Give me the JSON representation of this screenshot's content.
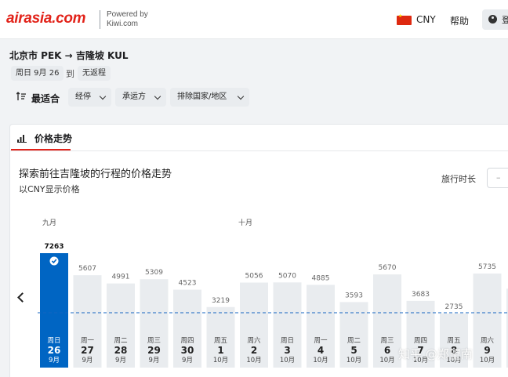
{
  "header": {
    "logo": "airasia.com",
    "powered_line1": "Powered by",
    "powered_line2": "Kiwi.com",
    "currency": "CNY",
    "help": "帮助",
    "account_label": "登"
  },
  "route": {
    "title": "北京市 PEK → 吉隆坡 KUL",
    "depart_chip": "周日 9月 26",
    "to_word": "到",
    "return_chip": "无返程"
  },
  "sort": {
    "label": "最适合"
  },
  "filters": [
    "经停",
    "承运方",
    "排除国家/地区"
  ],
  "tab": {
    "label": "价格走势"
  },
  "chart_panel": {
    "title": "探索前往吉隆坡的行程的价格走势",
    "subtitle": "以CNY显示价格",
    "duration_label": "旅行时长",
    "duration_value": "–",
    "month_sep": "九月",
    "month_oct": "十月"
  },
  "watermark": "知乎 @郑望南",
  "colors": {
    "brand": "#e2231a",
    "selected_bar": "#0065c3",
    "bar": "#e9ecef",
    "avg_line": "#1565c0"
  },
  "chart_data": {
    "type": "bar",
    "title": "",
    "selected_index": 0,
    "bars": [
      {
        "weekday": "周日",
        "day": "26",
        "month": "9月",
        "value": 7263
      },
      {
        "weekday": "周一",
        "day": "27",
        "month": "9月",
        "value": 5607
      },
      {
        "weekday": "周二",
        "day": "28",
        "month": "9月",
        "value": 4991
      },
      {
        "weekday": "周三",
        "day": "29",
        "month": "9月",
        "value": 5309
      },
      {
        "weekday": "周四",
        "day": "30",
        "month": "9月",
        "value": 4523
      },
      {
        "weekday": "周五",
        "day": "1",
        "month": "10月",
        "value": 3219
      },
      {
        "weekday": "周六",
        "day": "2",
        "month": "10月",
        "value": 5056
      },
      {
        "weekday": "周日",
        "day": "3",
        "month": "10月",
        "value": 5070
      },
      {
        "weekday": "周一",
        "day": "4",
        "month": "10月",
        "value": 4885
      },
      {
        "weekday": "周二",
        "day": "5",
        "month": "10月",
        "value": 3593
      },
      {
        "weekday": "周三",
        "day": "6",
        "month": "10月",
        "value": 5670
      },
      {
        "weekday": "周四",
        "day": "7",
        "month": "10月",
        "value": 3683
      },
      {
        "weekday": "周五",
        "day": "8",
        "month": "10月",
        "value": 2735
      },
      {
        "weekday": "周六",
        "day": "9",
        "month": "10月",
        "value": 5735
      },
      {
        "weekday": "",
        "day": "",
        "month": "",
        "value": 4600
      }
    ]
  }
}
